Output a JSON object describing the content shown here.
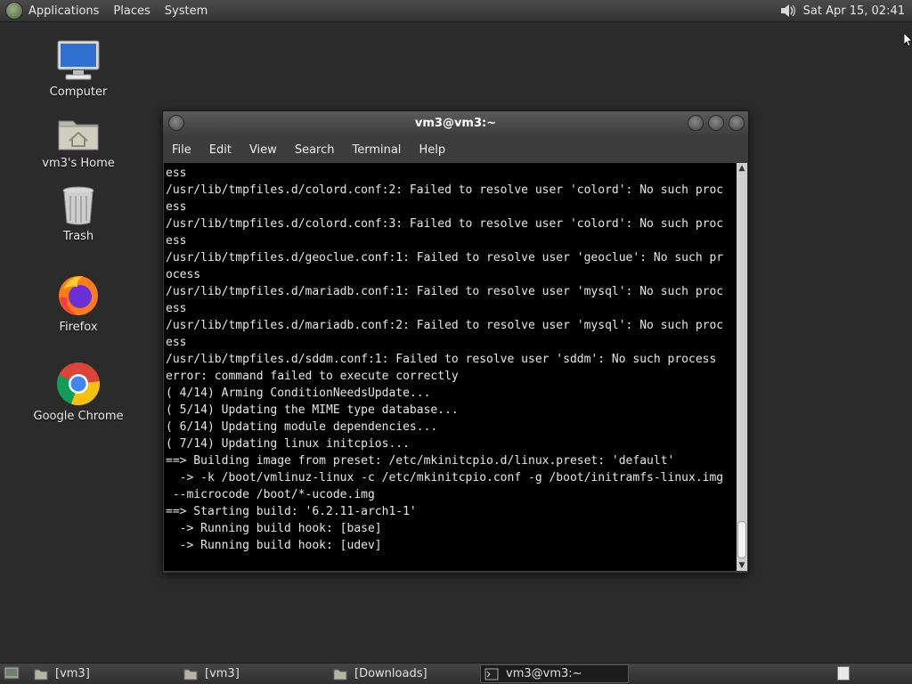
{
  "top_panel": {
    "applications_label": "Applications",
    "places_label": "Places",
    "system_label": "System",
    "clock": "Sat Apr 15, 02:41"
  },
  "desktop": {
    "icons": [
      {
        "label": "Computer",
        "icon": "computer-icon"
      },
      {
        "label": "vm3's Home",
        "icon": "home-folder-icon"
      },
      {
        "label": "Trash",
        "icon": "trash-icon"
      },
      {
        "label": "Firefox",
        "icon": "firefox-icon"
      },
      {
        "label": "Google Chrome",
        "icon": "chrome-icon"
      }
    ]
  },
  "terminal": {
    "title": "vm3@vm3:~",
    "menu": [
      "File",
      "Edit",
      "View",
      "Search",
      "Terminal",
      "Help"
    ],
    "lines": [
      "ess",
      "/usr/lib/tmpfiles.d/colord.conf:2: Failed to resolve user 'colord': No such proc",
      "ess",
      "/usr/lib/tmpfiles.d/colord.conf:3: Failed to resolve user 'colord': No such proc",
      "ess",
      "/usr/lib/tmpfiles.d/geoclue.conf:1: Failed to resolve user 'geoclue': No such pr",
      "ocess",
      "/usr/lib/tmpfiles.d/mariadb.conf:1: Failed to resolve user 'mysql': No such proc",
      "ess",
      "/usr/lib/tmpfiles.d/mariadb.conf:2: Failed to resolve user 'mysql': No such proc",
      "ess",
      "/usr/lib/tmpfiles.d/sddm.conf:1: Failed to resolve user 'sddm': No such process",
      "error: command failed to execute correctly",
      "( 4/14) Arming ConditionNeedsUpdate...",
      "( 5/14) Updating the MIME type database...",
      "( 6/14) Updating module dependencies...",
      "( 7/14) Updating linux initcpios...",
      "==> Building image from preset: /etc/mkinitcpio.d/linux.preset: 'default'",
      "  -> -k /boot/vmlinuz-linux -c /etc/mkinitcpio.conf -g /boot/initramfs-linux.img",
      " --microcode /boot/*-ucode.img",
      "==> Starting build: '6.2.11-arch1-1'",
      "  -> Running build hook: [base]",
      "  -> Running build hook: [udev]"
    ]
  },
  "taskbar": {
    "tasks": [
      {
        "label": "[vm3]",
        "icon": "folder-icon"
      },
      {
        "label": "[vm3]",
        "icon": "folder-icon"
      },
      {
        "label": "[Downloads]",
        "icon": "folder-icon"
      },
      {
        "label": "vm3@vm3:~",
        "icon": "terminal-icon"
      }
    ]
  }
}
